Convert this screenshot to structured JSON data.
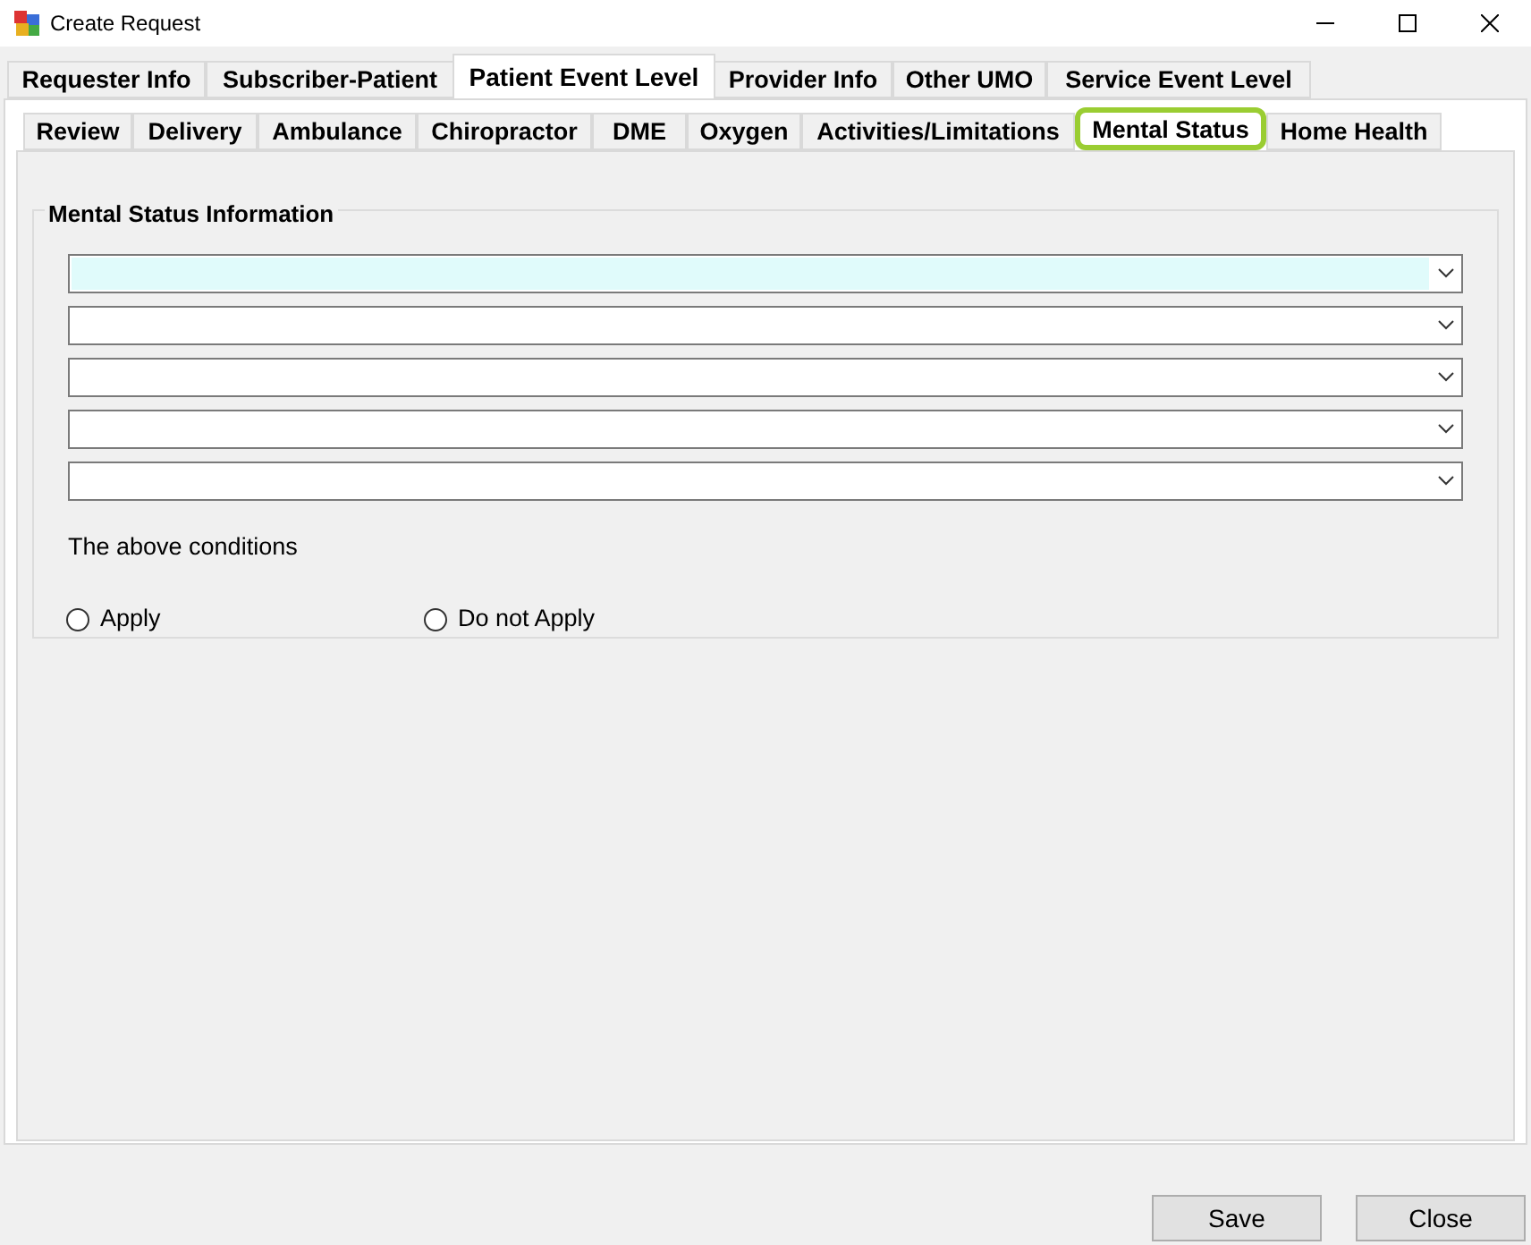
{
  "window": {
    "title": "Create Request"
  },
  "tabs": [
    {
      "label": "Requester Info",
      "selected": false
    },
    {
      "label": "Subscriber-Patient",
      "selected": false
    },
    {
      "label": "Patient Event Level",
      "selected": true
    },
    {
      "label": "Provider Info",
      "selected": false
    },
    {
      "label": "Other UMO",
      "selected": false
    },
    {
      "label": "Service Event Level",
      "selected": false
    }
  ],
  "subtabs": [
    {
      "label": "Review",
      "selected": false,
      "highlighted": false
    },
    {
      "label": "Delivery",
      "selected": false,
      "highlighted": false
    },
    {
      "label": "Ambulance",
      "selected": false,
      "highlighted": false
    },
    {
      "label": "Chiropractor",
      "selected": false,
      "highlighted": false
    },
    {
      "label": "DME",
      "selected": false,
      "highlighted": false
    },
    {
      "label": "Oxygen",
      "selected": false,
      "highlighted": false
    },
    {
      "label": "Activities/Limitations",
      "selected": false,
      "highlighted": false
    },
    {
      "label": "Mental Status",
      "selected": true,
      "highlighted": true
    },
    {
      "label": "Home Health",
      "selected": false,
      "highlighted": false
    }
  ],
  "group": {
    "title": "Mental Status Information",
    "dropdowns": [
      {
        "focused": true
      },
      {
        "focused": false
      },
      {
        "focused": false
      },
      {
        "focused": false
      },
      {
        "focused": false
      }
    ],
    "prompt": "The above conditions",
    "radios": [
      {
        "label": "Apply",
        "selected": false
      },
      {
        "label": "Do not Apply",
        "selected": false
      }
    ]
  },
  "buttons": [
    "Save",
    "Close"
  ]
}
